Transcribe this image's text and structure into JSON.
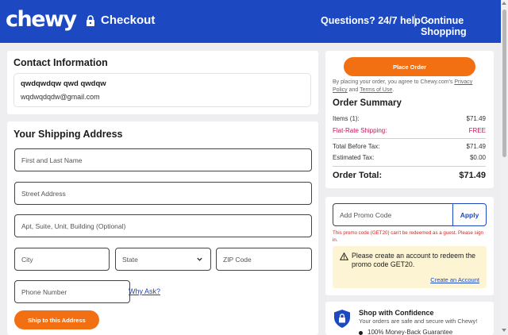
{
  "header": {
    "logo": "chewy",
    "checkout_label": "Checkout",
    "help_label": "Questions? 24/7 help",
    "continue_label": "Continue Shopping",
    "lock_icon": "lock-icon",
    "chevron_icon": "chevron-down-icon"
  },
  "contact": {
    "title": "Contact Information",
    "name": "qwdqwdqw qwd qwdqw",
    "email": "wqdwqdqdw@gmail.com"
  },
  "shipping": {
    "title": "Your Shipping Address",
    "name_placeholder": "First and Last Name",
    "street_placeholder": "Street Address",
    "apt_placeholder": "Apt, Suite, Unit, Building (Optional)",
    "city_placeholder": "City",
    "state_selected": "State",
    "zip_placeholder": "ZIP Code",
    "phone_placeholder": "Phone Number",
    "why_ask": "Why Ask?",
    "ship_button": "Ship to this Address"
  },
  "order": {
    "place_order": "Place Order",
    "agree_prefix": "By placing your order, you agree to Chewy.com's ",
    "privacy_link": "Privacy Policy",
    "agree_and": " and ",
    "terms_link": "Terms of Use",
    "agree_end": ".",
    "summary_title": "Order Summary",
    "items_label": "Items (1):",
    "items_value": "$71.49",
    "shipping_label": "Flat-Rate Shipping:",
    "shipping_value": "FREE",
    "before_tax_label": "Total Before Tax:",
    "before_tax_value": "$71.49",
    "tax_label": "Estimated Tax:",
    "tax_value": "$0.00",
    "total_label": "Order Total:",
    "total_value": "$71.49"
  },
  "promo": {
    "placeholder": "Add Promo Code",
    "apply": "Apply",
    "error": "This promo code (GET20) can't be redeemed as a guest. Please sign in.",
    "warning": "Please create an account to redeem the promo code GET20.",
    "create_account": "Create an Account",
    "warning_icon": "warning-icon"
  },
  "confidence": {
    "title": "Shop with Confidence",
    "subtitle": "Your orders are safe and secure with Chewy!",
    "item": "100% Money-Back Guarantee",
    "shield_icon": "shield-lock-icon"
  },
  "colors": {
    "brand_blue": "#1c49c2",
    "accent_orange": "#f26f12",
    "free_pink": "#c2185b",
    "warning_bg": "#fdf4d4"
  }
}
